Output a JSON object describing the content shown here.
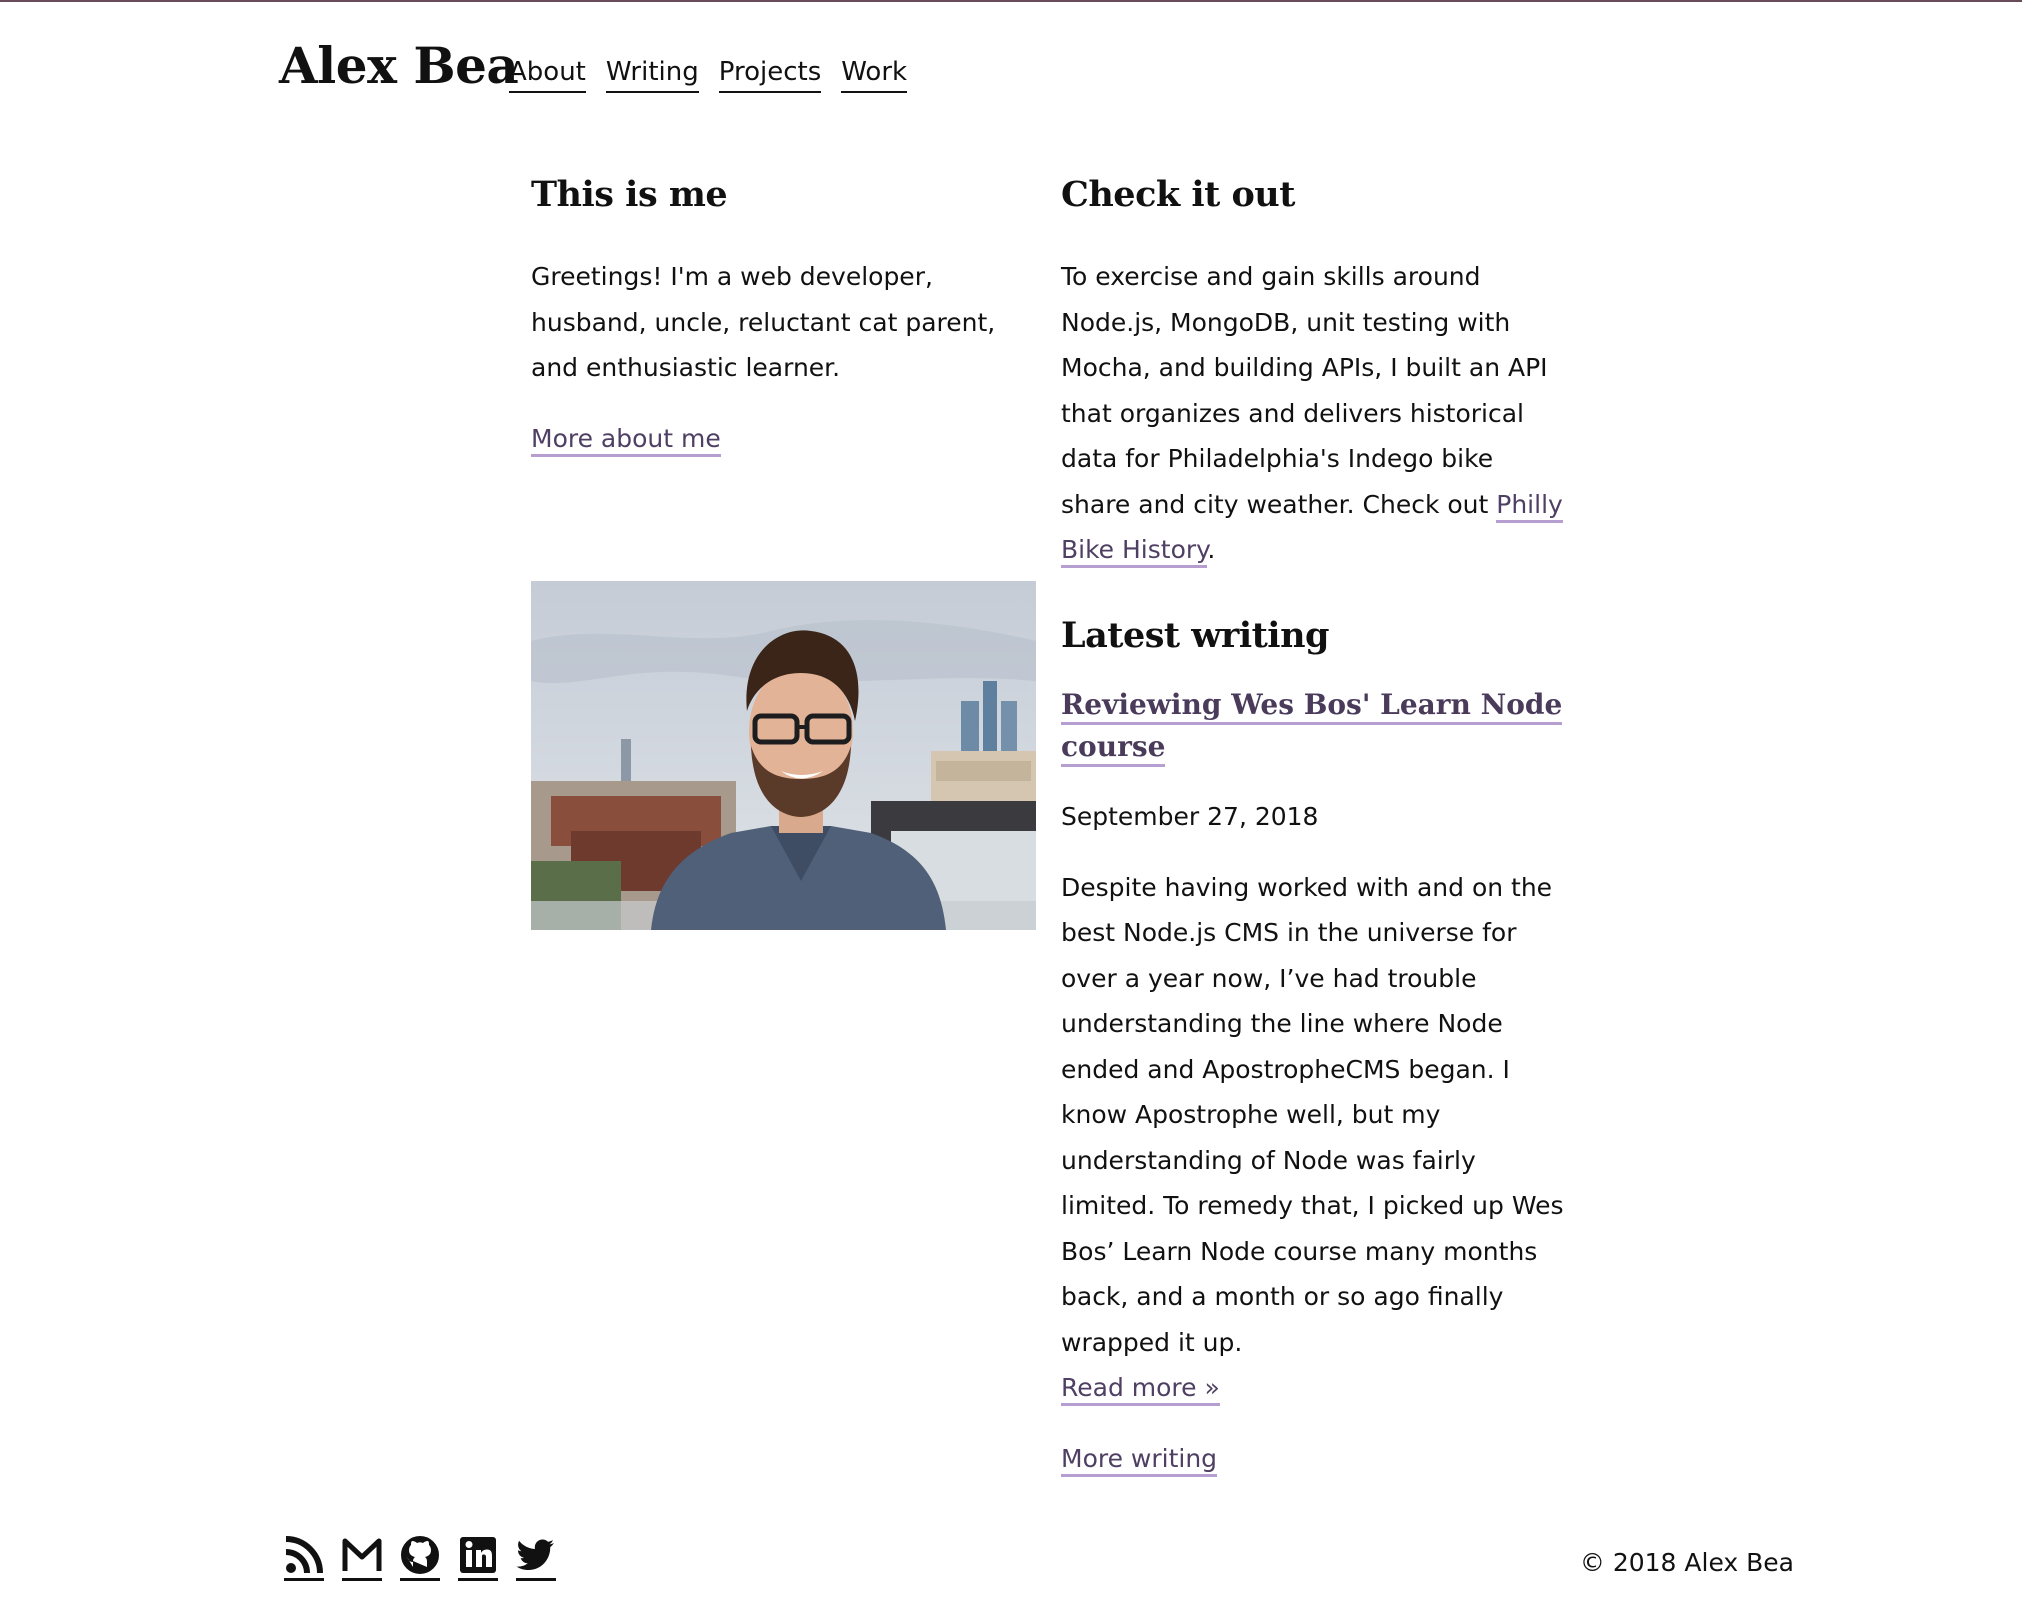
{
  "header": {
    "brand": "Alex Bea",
    "nav": [
      "About",
      "Writing",
      "Projects",
      "Work"
    ]
  },
  "about": {
    "heading": "This is me",
    "text": "Greetings! I'm a web developer, husband, uncle, reluctant cat parent, and enthusiastic learner.",
    "link": "More about me"
  },
  "project": {
    "heading": "Check it out",
    "text": "To exercise and gain skills around Node.js, MongoDB, unit testing with Mocha, and building APIs, I built an API that organizes and delivers historical data for Philadelphia's Indego bike share and city weather. Check out",
    "link": "Philly Bike History",
    "after": "."
  },
  "writing": {
    "heading": "Latest writing",
    "post_title": "Reviewing Wes Bos' Learn Node course",
    "date": "September 27, 2018",
    "excerpt": "Despite having worked with and on the best Node.js CMS in the universe for over a year now, I’ve had trouble understanding the line where Node ended and ApostropheCMS began. I know Apostrophe well, but my understanding of Node was fairly limited. To remedy that, I picked up Wes Bos’ Learn Node course many months back, and a month or so ago finally wrapped it up.",
    "read_more": "Read more »",
    "more_link": "More writing"
  },
  "footer": {
    "icons": [
      "rss-icon",
      "gmail-icon",
      "github-icon",
      "linkedin-icon",
      "twitter-icon"
    ],
    "copyright": "© 2018 Alex Bea"
  },
  "colors": {
    "link": "#4f3f63",
    "underline": "#b69ed1",
    "top_border": "#6b4a5a"
  }
}
